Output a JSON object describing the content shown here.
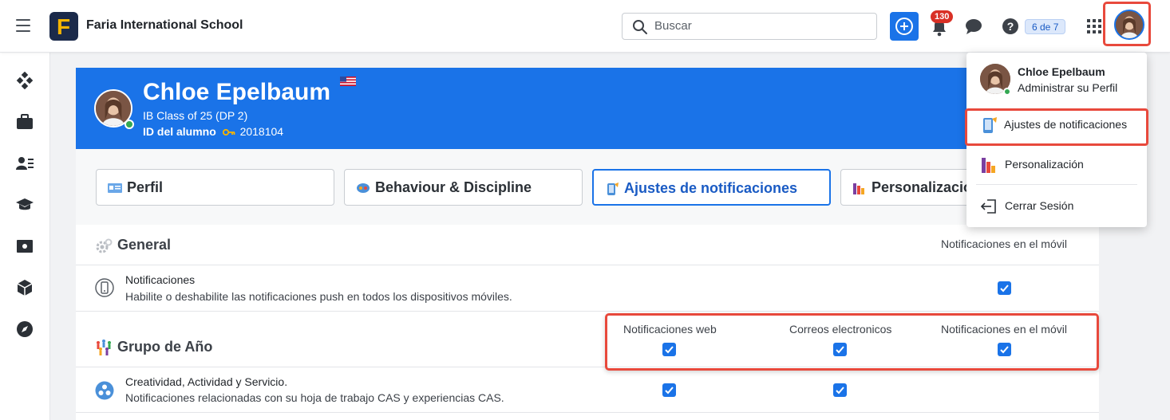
{
  "topbar": {
    "logo_letter": "F",
    "school_name": "Faria International School",
    "search_placeholder": "Buscar",
    "notification_count": "130",
    "counter": "6 de 7"
  },
  "profile": {
    "name": "Chloe Epelbaum",
    "class": "IB Class of 25 (DP 2)",
    "id_label": "ID del alumno",
    "id_value": "2018104"
  },
  "tabs": [
    {
      "label": "Perfil"
    },
    {
      "label": "Behaviour & Discipline"
    },
    {
      "label": "Ajustes de notificaciones"
    },
    {
      "label": "Personalizació"
    }
  ],
  "settings": {
    "general": {
      "title": "General",
      "col_mobile": "Notificaciones en el móvil",
      "rows": [
        {
          "title": "Notificaciones",
          "desc": "Habilite o deshabilite las notificaciones push en todos los dispositivos móviles.",
          "mobile": true
        }
      ]
    },
    "year_group": {
      "title": "Grupo de Año",
      "col_web": "Notificaciones web",
      "col_email": "Correos electronicos",
      "col_mobile": "Notificaciones en el móvil",
      "rows": [
        {
          "title": "Creatividad, Actividad y Servicio.",
          "desc": "Notificaciones relacionadas con su hoja de trabajo CAS y experiencias CAS.",
          "web": true,
          "email": true
        }
      ]
    }
  },
  "dropdown": {
    "name": "Chloe Epelbaum",
    "subtitle": "Administrar su Perfil",
    "items": [
      {
        "label": "Ajustes de notificaciones"
      },
      {
        "label": "Personalización"
      },
      {
        "label": "Cerrar Sesión"
      }
    ]
  },
  "colors": {
    "brand_blue": "#1a73e8",
    "highlight_red": "#e8493c",
    "online_green": "#34a853",
    "badge_red": "#d93025"
  }
}
